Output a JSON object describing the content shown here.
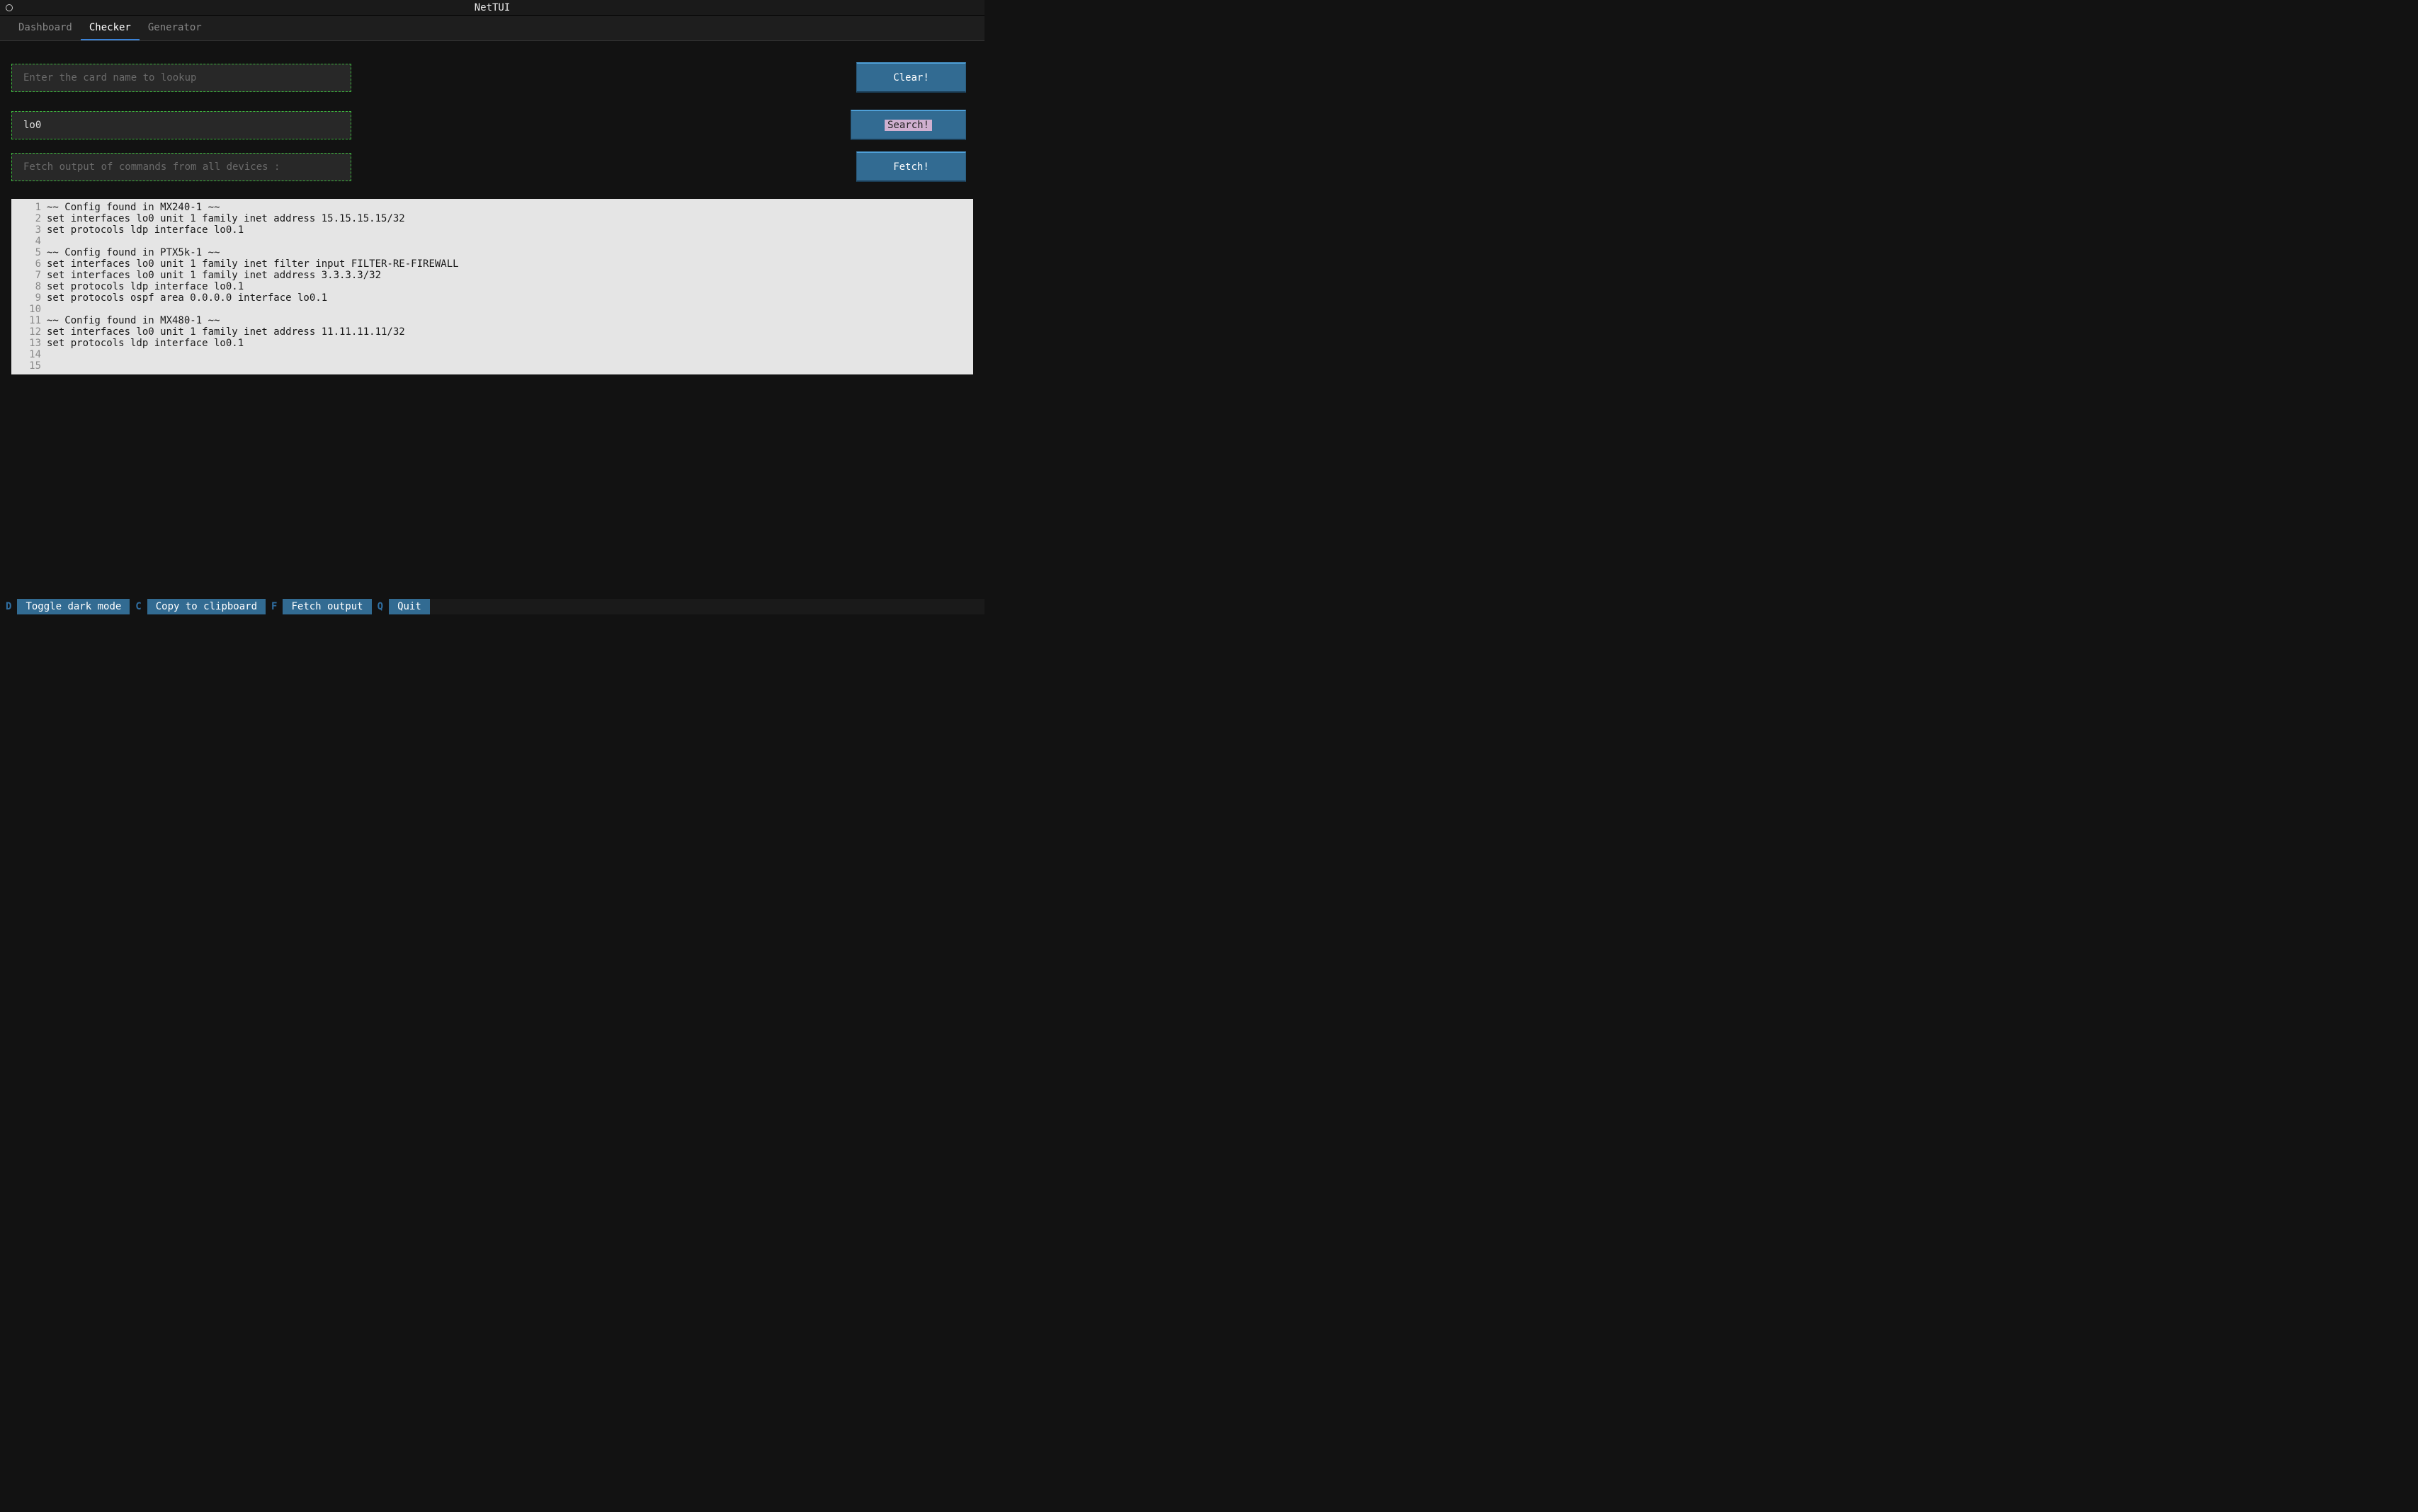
{
  "title": "NetTUI",
  "tabs": [
    {
      "label": "Dashboard",
      "active": false
    },
    {
      "label": "Checker",
      "active": true
    },
    {
      "label": "Generator",
      "active": false
    }
  ],
  "inputs": {
    "card_lookup": {
      "placeholder": "Enter the card name to lookup",
      "value": ""
    },
    "search": {
      "placeholder": "",
      "value": "lo0"
    },
    "fetch": {
      "text": "Fetch output of commands from all devices :"
    }
  },
  "buttons": {
    "clear": "Clear!",
    "search": "Search!",
    "fetch": "Fetch!"
  },
  "output_lines": [
    "~~ Config found in MX240-1 ~~",
    "set interfaces lo0 unit 1 family inet address 15.15.15.15/32",
    "set protocols ldp interface lo0.1",
    "",
    "~~ Config found in PTX5k-1 ~~",
    "set interfaces lo0 unit 1 family inet filter input FILTER-RE-FIREWALL",
    "set interfaces lo0 unit 1 family inet address 3.3.3.3/32",
    "set protocols ldp interface lo0.1",
    "set protocols ospf area 0.0.0.0 interface lo0.1",
    "",
    "~~ Config found in MX480-1 ~~",
    "set interfaces lo0 unit 1 family inet address 11.11.11.11/32",
    "set protocols ldp interface lo0.1",
    "",
    ""
  ],
  "footer": [
    {
      "key": "D",
      "label": "Toggle dark mode"
    },
    {
      "key": "C",
      "label": "Copy to clipboard"
    },
    {
      "key": "F",
      "label": "Fetch output"
    },
    {
      "key": "Q",
      "label": "Quit"
    }
  ]
}
